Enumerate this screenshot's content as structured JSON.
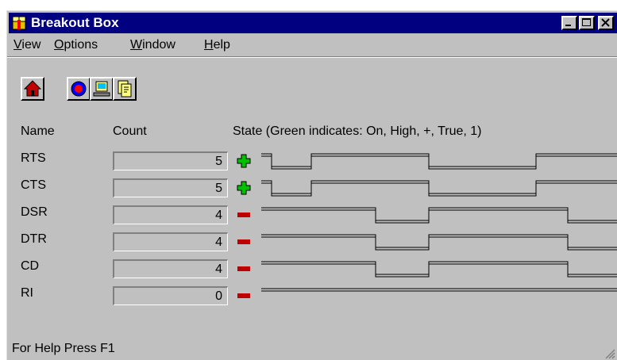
{
  "window": {
    "title": "Breakout Box",
    "app_icon": "breakout-box-icon"
  },
  "title_buttons": [
    {
      "name": "minimize",
      "icon": "minimize-icon"
    },
    {
      "name": "maximize",
      "icon": "maximize-icon"
    },
    {
      "name": "close",
      "icon": "close-icon"
    }
  ],
  "menu": {
    "items": [
      {
        "label": "View",
        "underline": "V"
      },
      {
        "label": "Options",
        "underline": "O"
      },
      {
        "label": "Window",
        "underline": "W"
      },
      {
        "label": "Help",
        "underline": "H"
      }
    ]
  },
  "toolbar": {
    "buttons": [
      {
        "name": "home",
        "icon": "home-icon"
      },
      {
        "name": "record",
        "icon": "record-icon"
      },
      {
        "name": "monitor",
        "icon": "monitor-icon"
      },
      {
        "name": "copy",
        "icon": "copy-icon"
      }
    ]
  },
  "headers": {
    "name": "Name",
    "count": "Count",
    "state": "State (Green indicates: On, High, +, True, 1)"
  },
  "signals": [
    {
      "name": "RTS",
      "count": "5",
      "state": "on",
      "edges": [
        0.03,
        0.14,
        0.47,
        0.77
      ]
    },
    {
      "name": "CTS",
      "count": "5",
      "state": "on",
      "edges": [
        0.03,
        0.14,
        0.47,
        0.77
      ]
    },
    {
      "name": "DSR",
      "count": "4",
      "state": "off",
      "edges": [
        0.32,
        0.47,
        0.86
      ]
    },
    {
      "name": "DTR",
      "count": "4",
      "state": "off",
      "edges": [
        0.32,
        0.47,
        0.86
      ]
    },
    {
      "name": "CD",
      "count": "4",
      "state": "off",
      "edges": [
        0.32,
        0.47,
        0.86
      ]
    },
    {
      "name": "RI",
      "count": "0",
      "state": "off",
      "edges": []
    }
  ],
  "colors": {
    "on": "#00c000",
    "off": "#c00000",
    "titlebar": "#000080",
    "face": "#c0c0c0"
  },
  "status": {
    "text": "For Help Press F1"
  }
}
